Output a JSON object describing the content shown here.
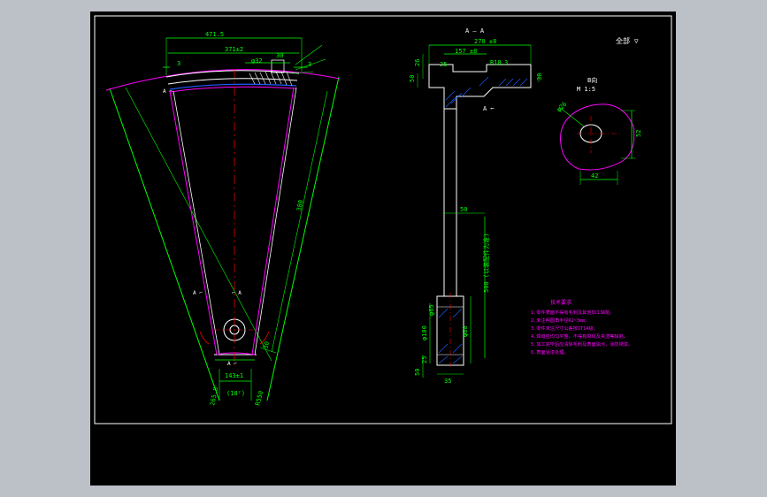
{
  "colors": {
    "background": "#000000",
    "frame": "#ffffff",
    "dimension": "#00ff00",
    "outline": "#ffffff",
    "contour": "#ff00ff",
    "centerline": "#ff0000",
    "note": "#ff00ff",
    "hatch": "#1e5aff"
  },
  "title": "全部 ▽",
  "views": {
    "front": {
      "dims": {
        "top_outer": "471.5",
        "top_mid": "371±2",
        "small_dia": "φ32",
        "d30": "30",
        "d3_left": "3",
        "d3_right": "3",
        "radius": "380",
        "bottom_width": "143±1",
        "bottom_lower": "(18²)",
        "left_angle": "265.8",
        "right_angle": "R550",
        "d30_side": "30"
      },
      "labels": {
        "a_left": "A ⌐",
        "a_mid": "⌐ A",
        "a_top": "A ⌐",
        "a_bottom": "A ⌐"
      }
    },
    "section": {
      "title": "A — A",
      "dims": {
        "top_width": "270 ±8",
        "inner_width": "157 ±8",
        "d26": "26",
        "d25": "25",
        "r18": "R18",
        "r3": "3",
        "d30": "30",
        "d50_side": "50",
        "d50": "50",
        "d500": "500 (以装配件为准)",
        "d65": "φ65",
        "d100": "φ100",
        "d80": "φ80",
        "d25b": "25",
        "d50b": "50",
        "d35": "35",
        "label_a": "A ⌐"
      }
    },
    "detail": {
      "title": "B向",
      "scale": "M 1:5",
      "dims": {
        "d26": "φ26",
        "d52": "52",
        "d42": "42"
      }
    }
  },
  "notes": {
    "title": "技术要求",
    "items": [
      "1.零件表面不得有毛刺及其他加工缺陷。",
      "2.未注明圆角半径R2~3mm。",
      "3.零件未注尺寸公差按IT14级。",
      "4.焊缝应均匀平整，不得有裂纹及夹渣等缺陷。",
      "5.加工完毕后应清除毛刺及表面油污，涂防锈漆。",
      "6.表面涂漆处理。"
    ]
  }
}
